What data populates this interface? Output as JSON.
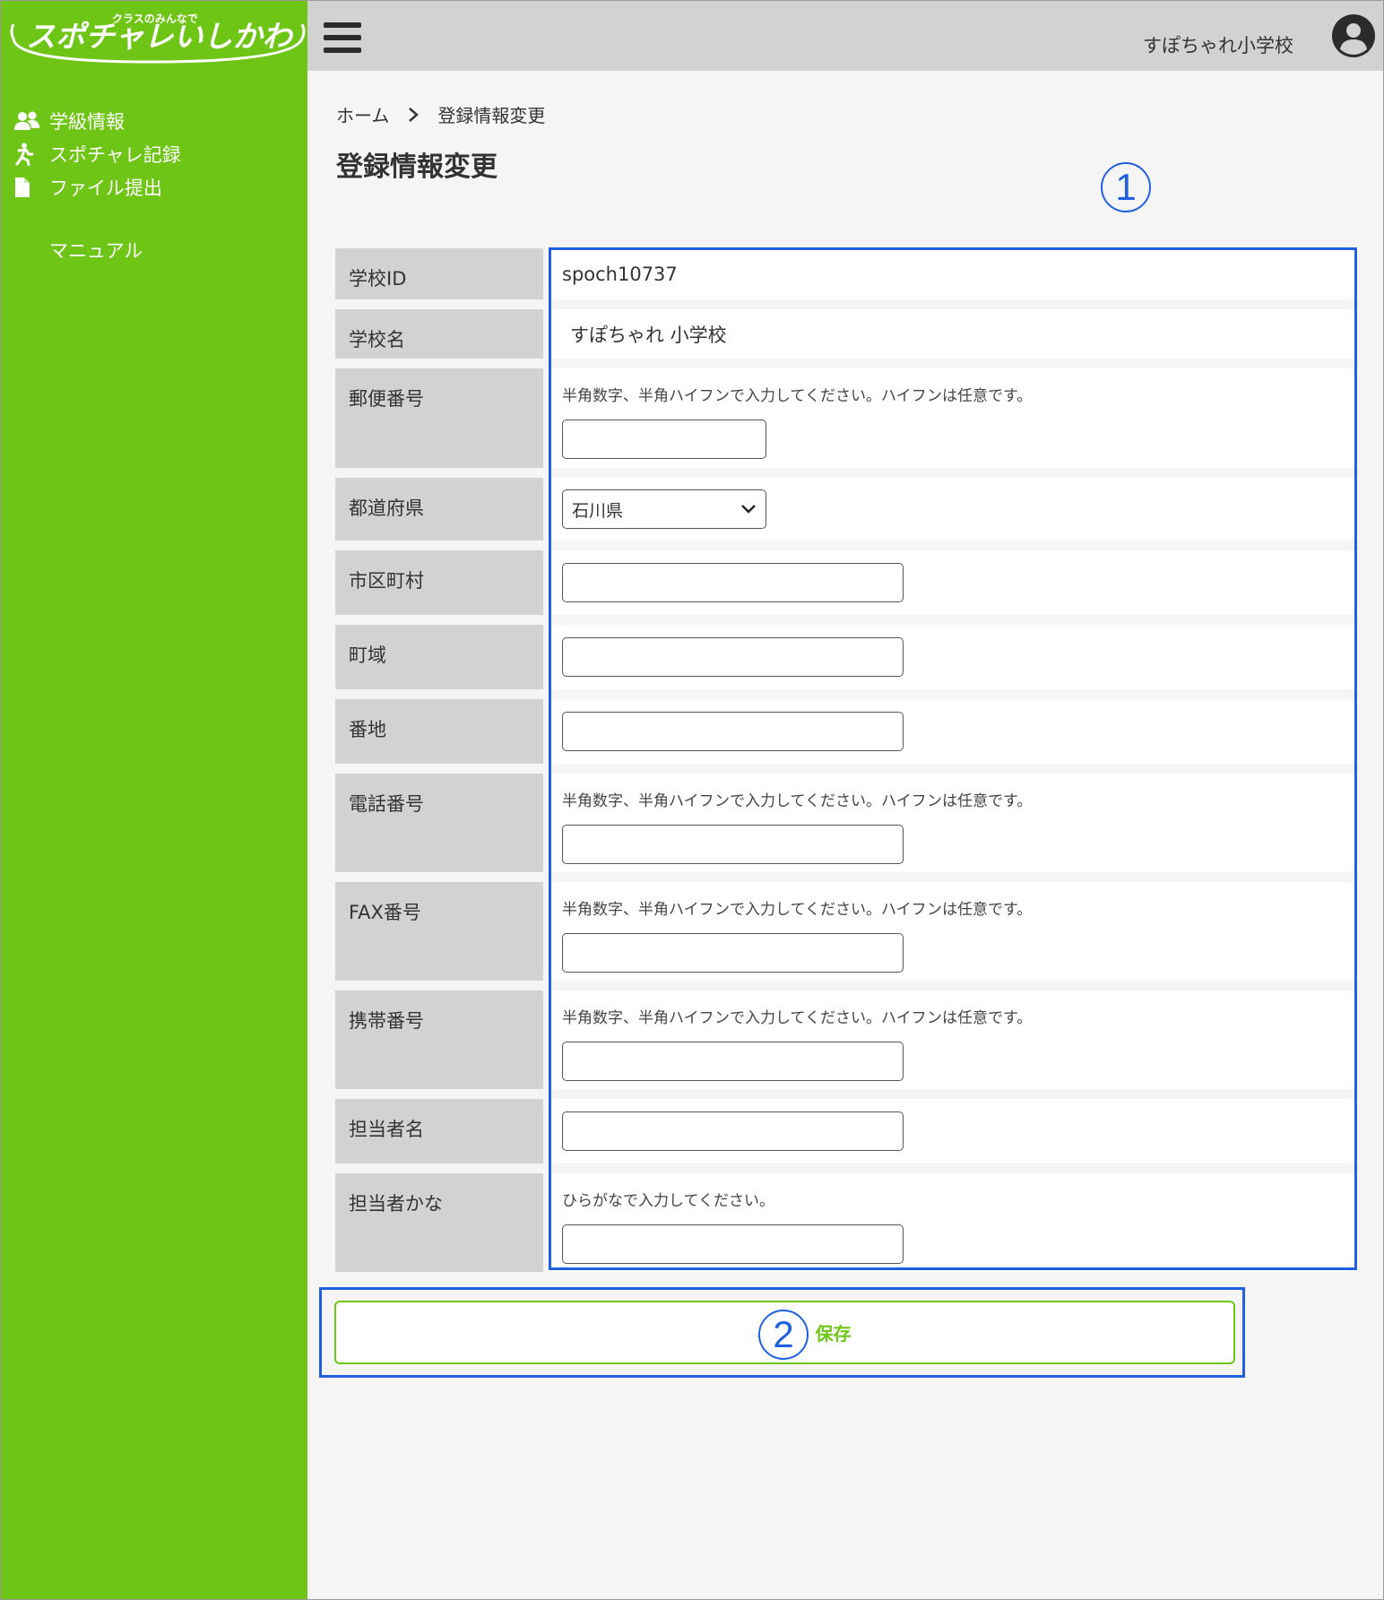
{
  "brand": {
    "tagline": "クラスのみんなで",
    "name": "スポチャレいしかわ"
  },
  "sidebar": {
    "items": [
      {
        "label": "学級情報",
        "icon": "users-icon"
      },
      {
        "label": "スポチャレ記録",
        "icon": "running-icon"
      },
      {
        "label": "ファイル提出",
        "icon": "file-icon"
      },
      {
        "label": "マニュアル",
        "icon": ""
      }
    ]
  },
  "header": {
    "school_name": "すぽちゃれ小学校",
    "menu_icon": "hamburger-icon",
    "user_icon": "user-avatar-icon"
  },
  "breadcrumb": {
    "home": "ホーム",
    "current": "登録情報変更"
  },
  "page": {
    "title": "登録情報変更"
  },
  "form": {
    "school_id": {
      "label": "学校ID",
      "value": "spoch10737"
    },
    "school_name": {
      "label": "学校名",
      "value": "すぽちゃれ 小学校"
    },
    "postal_code": {
      "label": "郵便番号",
      "hint": "半角数字、半角ハイフンで入力してください。ハイフンは任意です。",
      "value": ""
    },
    "prefecture": {
      "label": "都道府県",
      "selected": "石川県"
    },
    "city": {
      "label": "市区町村",
      "value": ""
    },
    "town": {
      "label": "町域",
      "value": ""
    },
    "address": {
      "label": "番地",
      "value": ""
    },
    "phone": {
      "label": "電話番号",
      "hint": "半角数字、半角ハイフンで入力してください。ハイフンは任意です。",
      "value": ""
    },
    "fax": {
      "label": "FAX番号",
      "hint": "半角数字、半角ハイフンで入力してください。ハイフンは任意です。",
      "value": ""
    },
    "mobile": {
      "label": "携帯番号",
      "hint": "半角数字、半角ハイフンで入力してください。ハイフンは任意です。",
      "value": ""
    },
    "contact_name": {
      "label": "担当者名",
      "value": ""
    },
    "contact_kana": {
      "label": "担当者かな",
      "hint": "ひらがなで入力してください。",
      "value": ""
    }
  },
  "save_button": {
    "label": "保存"
  },
  "annotations": {
    "marker1": "1",
    "marker2": "2",
    "highlight_color": "#1f5fe0"
  },
  "colors": {
    "brand_green": "#6fc516",
    "header_gray": "#d2d2d2",
    "label_gray": "#d2d2d2"
  }
}
